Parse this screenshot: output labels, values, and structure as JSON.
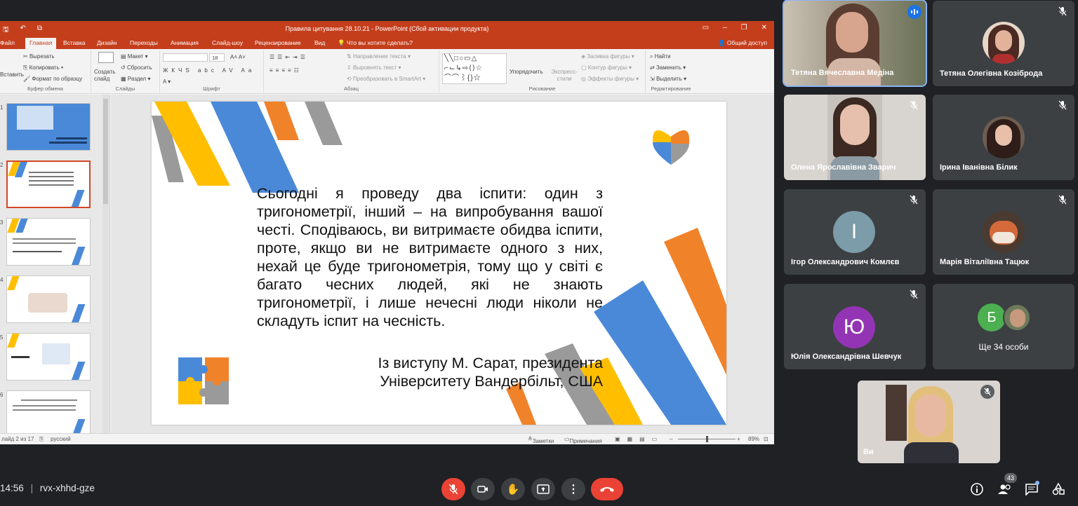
{
  "powerpoint": {
    "window_title": "Правила цитування 28.10.21 - PowerPoint (Сбой активации продукта)",
    "tabs": [
      "Файл",
      "Главная",
      "Вставка",
      "Дизайн",
      "Переходы",
      "Анимация",
      "Слайд-шоу",
      "Рецензирование",
      "Вид"
    ],
    "tell_me": "Что вы хотите сделать?",
    "share": "Общий доступ",
    "ribbon": {
      "paste": "Вставить",
      "cut": "Вырезать",
      "copy": "Копировать",
      "format_painter": "Формат по образцу",
      "new_slide": "Создать слайд",
      "layout": "Макет",
      "reset": "Сбросить",
      "section": "Раздел",
      "font_size": "18",
      "text_direction": "Направление текста",
      "align_text": "Выровнять текст",
      "smartart": "Преобразовать в SmartArt",
      "arrange": "Упорядочить",
      "quick_styles": "Экспресс-стили",
      "shape_fill": "Заливка фигуры",
      "shape_outline": "Контур фигуры",
      "shape_effects": "Эффекты фигуры",
      "find": "Найти",
      "replace": "Заменить",
      "select": "Выделить",
      "groups": {
        "clipboard": "Буфер обмена",
        "slides": "Слайды",
        "font": "Шрифт",
        "paragraph": "Абзац",
        "drawing": "Рисование",
        "editing": "Редактирование"
      }
    },
    "thumb_numbers": [
      "1",
      "2",
      "3",
      "4",
      "5",
      "6"
    ],
    "slide": {
      "quote": "Сьогодні я проведу два іспити: один з тригонометрії, інший – на випробування вашої честі. Сподіваюсь, ви витримаєте обидва іспити, проте, якщо ви не витримаєте одного з них, нехай це буде тригонометрія, тому що у світі є багато чесних людей, які не знають тригонометрії, і лише нечесні люди ніколи не складуть іспит на чесність.",
      "attribution_line1": "Із виступу М. Сарат, президента",
      "attribution_line2": "Університету Вандербільт, США"
    },
    "status": {
      "slide_info": "лайд 2 из 17",
      "language": "русский",
      "notes": "Заметки",
      "comments": "Примечания",
      "zoom": "89%"
    }
  },
  "participants": [
    {
      "name": "Тетяна Вячеславна Медіна",
      "speaking": true
    },
    {
      "name": "Тетяна Олегівна Козіброда",
      "muted": true
    },
    {
      "name": "Олена Ярославівна Зварич",
      "muted": true
    },
    {
      "name": "Ірина Іванівна Білик",
      "muted": true
    },
    {
      "name": "Ігор Олександрович Комлєв",
      "initial": "І",
      "muted": true
    },
    {
      "name": "Марія Віталіївна Тацюк",
      "muted": true
    },
    {
      "name": "Юлія Олександрівна Шевчук",
      "initial": "Ю",
      "muted": true
    }
  ],
  "others": {
    "initial": "Б",
    "label": "Ще 34 особи"
  },
  "self_label": "Ви",
  "meeting": {
    "time": "14:56",
    "code": "rvx-xhhd-gze",
    "people_count": "43"
  },
  "colors": {
    "ppt_red": "#c43e1c",
    "meet_bg": "#202124",
    "tile_bg": "#3c4043",
    "hangup_red": "#ea4335",
    "slide_blue": "#4a89d8",
    "slide_yellow": "#ffbf00",
    "slide_orange": "#f0822a",
    "slide_gray": "#9a9a9a"
  }
}
